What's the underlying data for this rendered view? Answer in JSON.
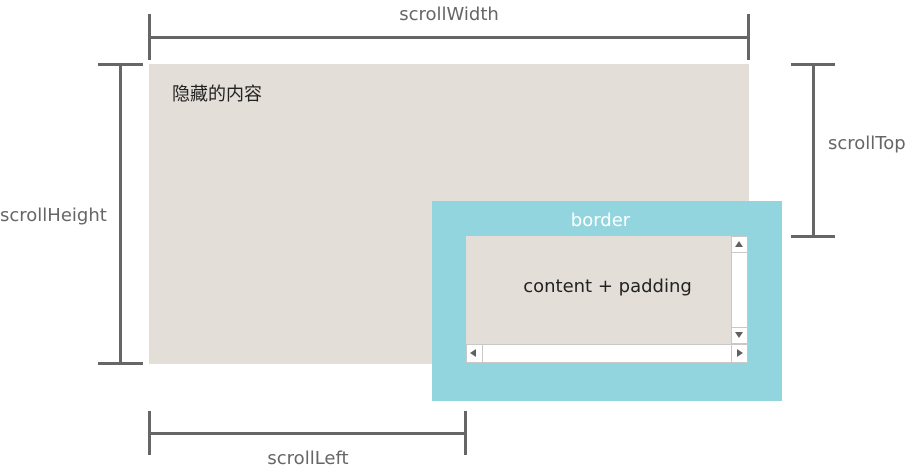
{
  "labels": {
    "scroll_width": "scrollWidth",
    "scroll_height": "scrollHeight",
    "scroll_top": "scrollTop",
    "scroll_left": "scrollLeft",
    "hidden_content": "隐藏的内容",
    "border": "border",
    "content_padding": "content + padding"
  },
  "colors": {
    "content_fill": "#e3ded7",
    "border_fill": "#93d5de",
    "dimension_line": "#666666",
    "border_text": "#ffffff"
  }
}
